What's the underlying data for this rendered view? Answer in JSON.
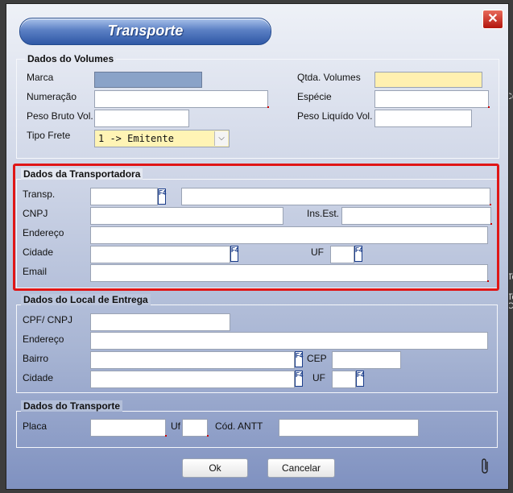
{
  "window": {
    "title": "Transporte",
    "close_label": "✕"
  },
  "volumes": {
    "legend": "Dados do Volumes",
    "marca_label": "Marca",
    "qtda_label": "Qtda. Volumes",
    "numeracao_label": "Numeração",
    "especie_label": "Espécie",
    "peso_bruto_label": "Peso Bruto Vol.",
    "peso_liquido_label": "Peso Liquído Vol.",
    "tipo_frete_label": "Tipo Frete",
    "tipo_frete_value": "1 -> Emitente"
  },
  "transportadora": {
    "legend": "Dados da Transportadora",
    "transp_label": "Transp.",
    "cnpj_label": "CNPJ",
    "ins_est_label": "Ins.Est.",
    "endereco_label": "Endereço",
    "cidade_label": "Cidade",
    "uf_label": "UF",
    "email_label": "Email"
  },
  "entrega": {
    "legend": "Dados do Local de Entrega",
    "cpf_label": "CPF/ CNPJ",
    "endereco_label": "Endereço",
    "bairro_label": "Bairro",
    "cep_label": "CEP",
    "cidade_label": "Cidade",
    "uf_label": "UF"
  },
  "transporte": {
    "legend": "Dados do Transporte",
    "placa_label": "Placa",
    "uf_label": "Uf",
    "antt_label": "Cód. ANTT"
  },
  "lookup_key": "F4",
  "buttons": {
    "ok": "Ok",
    "cancel": "Cancelar"
  },
  "side": {
    "t1": "Co",
    "t2": "To",
    "t3": "To",
    "t4": "C"
  }
}
